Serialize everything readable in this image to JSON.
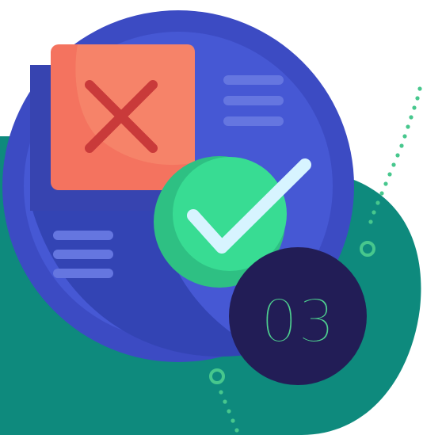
{
  "illustration": {
    "badge_number": "03",
    "icons": {
      "reject": "x-mark-icon",
      "approve": "check-mark-icon"
    },
    "colors": {
      "background": "#ffffff",
      "teal": "#0e8a7d",
      "big_circle": "#3c4bc3",
      "big_circle_inner": "#4658d4",
      "card_red": "#f4735f",
      "x_mark": "#c93a3a",
      "check_circle": "#34d98f",
      "check_mark": "#d7f4ff",
      "badge": "#221d56",
      "badge_text": "#4ecf8f",
      "dots": "#47c78d"
    }
  }
}
